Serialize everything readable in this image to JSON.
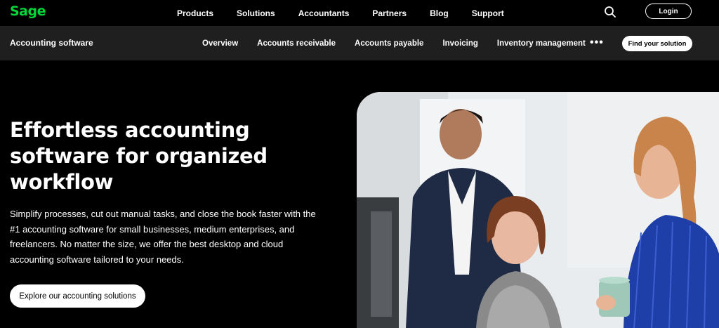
{
  "brand": {
    "logo_text": "Sage",
    "accent_color": "#00d639"
  },
  "topnav": {
    "items": [
      "Products",
      "Solutions",
      "Accountants",
      "Partners",
      "Blog",
      "Support"
    ],
    "search_icon": "search-icon",
    "login_label": "Login"
  },
  "subnav": {
    "title": "Accounting software",
    "items": [
      "Overview",
      "Accounts receivable",
      "Accounts payable",
      "Invoicing",
      "Inventory management"
    ],
    "more_label": "•••",
    "cta_label": "Find your solution"
  },
  "hero": {
    "title": "Effortless accounting software for organized workflow",
    "description": "Simplify processes, cut out manual tasks, and close the book faster with the #1 accounting software for small businesses, medium enterprises, and freelancers. No matter the size, we offer the best desktop and cloud accounting software tailored to your needs.",
    "button_label": "Explore our accounting solutions",
    "image": "office-team-photo"
  }
}
